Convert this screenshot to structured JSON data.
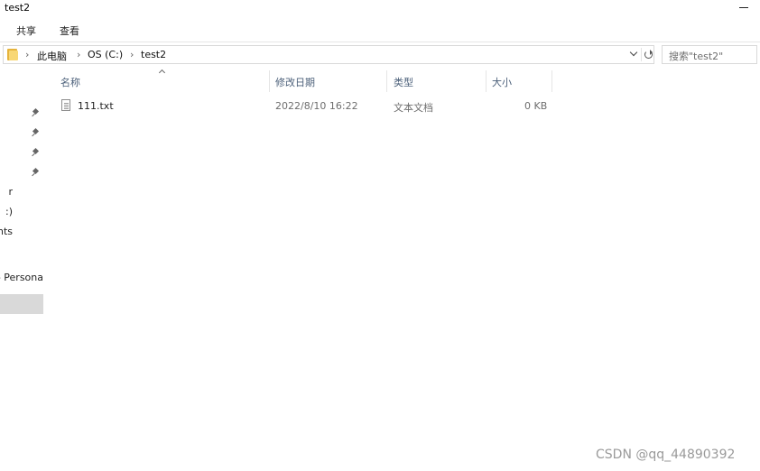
{
  "window": {
    "title": "test2"
  },
  "ribbon": {
    "tabs": [
      "共享",
      "查看"
    ]
  },
  "address": {
    "crumbs": [
      "此电脑",
      "OS (C:)",
      "test2"
    ]
  },
  "search": {
    "placeholder": "搜索\"test2\""
  },
  "nav": {
    "items": [
      "r",
      ":)",
      "nts",
      "- Persona"
    ]
  },
  "columns": {
    "name": "名称",
    "date": "修改日期",
    "type": "类型",
    "size": "大小"
  },
  "files": [
    {
      "name": "111.txt",
      "date": "2022/8/10 16:22",
      "type": "文本文档",
      "size": "0 KB",
      "icon": "text-file-icon"
    }
  ],
  "watermark": "CSDN @qq_44890392"
}
